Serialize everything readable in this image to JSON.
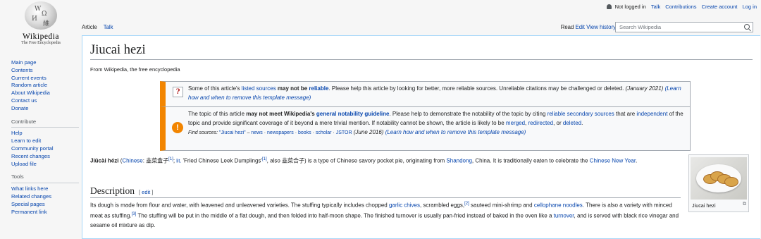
{
  "logo": {
    "wordmark": "Wikipedia",
    "tagline": "The Free Encyclopedia"
  },
  "personal": {
    "not_logged_in": "Not logged in",
    "links": [
      "Talk",
      "Contributions",
      "Create account",
      "Log in"
    ]
  },
  "tabs_left": [
    "Article",
    "Talk"
  ],
  "tabs_right": [
    "Read",
    "Edit",
    "View history"
  ],
  "search": {
    "placeholder": "Search Wikipedia"
  },
  "sidebar": {
    "nav": [
      "Main page",
      "Contents",
      "Current events",
      "Random article",
      "About Wikipedia",
      "Contact us",
      "Donate"
    ],
    "contribute_heading": "Contribute",
    "contribute": [
      "Help",
      "Learn to edit",
      "Community portal",
      "Recent changes",
      "Upload file"
    ],
    "tools_heading": "Tools",
    "tools": [
      "What links here",
      "Related changes",
      "Special pages",
      "Permanent link"
    ]
  },
  "article": {
    "title": "Jiucai hezi",
    "tagline": "From Wikipedia, the free encyclopedia",
    "box1": {
      "t1": "Some of this article's ",
      "l1": "listed sources",
      "t2": " may not be ",
      "l2": "reliable",
      "t3": ". Please help this article by looking for better, more reliable sources. Unreliable citations may be challenged or deleted. ",
      "t4": "(January 2021) ",
      "l3": "(Learn how and when to remove this template message)"
    },
    "box2": {
      "t1": "The topic of this article ",
      "t2": "may not meet Wikipedia's ",
      "l1": "general notability guideline",
      "t3": ". Please help to demonstrate the notability of the topic by citing ",
      "l2": "reliable secondary sources",
      "t4": " that are ",
      "l3": "independent",
      "t5": " of the topic and provide significant coverage of it beyond a mere trivial mention. If notability cannot be shown, the article is likely to be ",
      "l4": "merged",
      "t6": ", ",
      "l5": "redirected",
      "t7": ", or ",
      "l6": "deleted",
      "t8": ".",
      "find_label": "Find sources: ",
      "find_query": "\"Jiucai hezi\"",
      "find_dash": " – ",
      "find_links": [
        "news",
        "newspapers",
        "books",
        "scholar",
        "JSTOR"
      ],
      "find_date": " (June 2016) ",
      "find_learn": "(Learn how and when to remove this template message)"
    },
    "intro": {
      "term": "Jiǔcài hézi",
      "open": " (",
      "lang": "Chinese",
      "chinese1": ": 韭菜盒子",
      "ref1": "[1]",
      "sep": "; ",
      "lit": "lit.",
      "t1": " 'Fried Chinese Leek Dumplings'",
      "ref2": "[1]",
      "t2": ", also 韭菜合子) is a type of Chinese savory pocket pie, originating from ",
      "place": "Shandong",
      "t3": ", China. It is traditionally eaten to celebrate the ",
      "holiday": "Chinese New Year",
      "t4": "."
    },
    "section": {
      "title": "Description",
      "edit_open": "[ ",
      "edit": "edit",
      "edit_close": " ]"
    },
    "desc": {
      "t1": "Its dough is made from flour and water, with leavened and unleavened varieties. The stuffing typically includes chopped ",
      "l1": "garlic chives",
      "t2": ", scrambled eggs,",
      "ref2": "[2]",
      "t3": " sauteed mini-shrimp and ",
      "l2": "cellophane noodles",
      "t4": ". There is also a variety with minced meat as stuffing.",
      "ref3": "[3]",
      "t5": " The stuffing will be put in the middle of a flat dough, and then folded into half-moon shape. The finished turnover is usually pan-fried instead of baked in the oven like a ",
      "l3": "turnover",
      "t6": ", and is served with black rice vinegar and sesame oil mixture as dip."
    },
    "thumb_caption": "Jiucai hezi"
  }
}
